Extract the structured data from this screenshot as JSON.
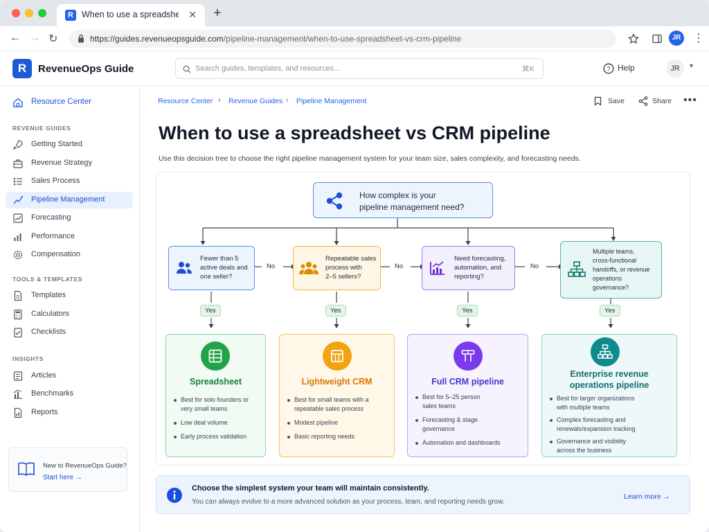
{
  "browser": {
    "tab_title": "When to use a spreadsheet vs CRM pipeline",
    "url_host": "https://guides.revenueopsguide.com",
    "url_path": "/pipeline-management/when-to-use-spreadsheet-vs-crm-pipeline",
    "profile": "JR"
  },
  "header": {
    "logo_letter": "R",
    "brand": "RevenueOps Guide",
    "search_placeholder": "Search guides, templates, and resources...",
    "search_shortcut": "⌘K",
    "help": "Help",
    "user_initials": "JR"
  },
  "sidebar": {
    "home": "Resource Center",
    "sections": [
      {
        "title": "REVENUE GUIDES",
        "items": [
          "Getting Started",
          "Revenue Strategy",
          "Sales Process",
          "Pipeline Management",
          "Forecasting",
          "Performance",
          "Compensation"
        ]
      },
      {
        "title": "TOOLS & TEMPLATES",
        "items": [
          "Templates",
          "Calculators",
          "Checklists"
        ]
      },
      {
        "title": "INSIGHTS",
        "items": [
          "Articles",
          "Benchmarks",
          "Reports"
        ]
      }
    ],
    "active_item": "Pipeline Management",
    "promo_title": "New to RevenueOps Guide?",
    "promo_link": "Start here →"
  },
  "main": {
    "breadcrumb": [
      "Resource Center",
      "Revenue Guides",
      "Pipeline Management"
    ],
    "save": "Save",
    "share": "Share",
    "title": "When to use a spreadsheet vs CRM pipeline",
    "subtitle": "Use this decision tree to choose the right pipeline management system for your team size, sales complexity, and forecasting needs."
  },
  "tree": {
    "root": [
      "How complex is your",
      "pipeline management need?"
    ],
    "no_label": "No",
    "yes_label": "Yes",
    "questions": [
      [
        "Fewer than 5",
        "active deals and",
        "one seller?"
      ],
      [
        "Repeatable sales",
        "process with",
        "2–5 sellers?"
      ],
      [
        "Need forecasting,",
        "automation, and",
        "reporting?"
      ],
      [
        "Multiple teams,",
        "cross-functional",
        "handoffs, or revenue",
        "operations",
        "governance?"
      ]
    ],
    "results": [
      {
        "title": [
          "Spreadsheet"
        ],
        "bullets": [
          [
            "Best for solo founders or",
            "very small teams"
          ],
          [
            "Low deal volume"
          ],
          [
            "Early process validation"
          ]
        ]
      },
      {
        "title": [
          "Lightweight CRM"
        ],
        "bullets": [
          [
            "Best for small teams with a",
            "repeatable sales process"
          ],
          [
            "Modest pipeline"
          ],
          [
            "Basic reporting needs"
          ]
        ]
      },
      {
        "title": [
          "Full CRM pipeline"
        ],
        "bullets": [
          [
            "Best for 5–25 person",
            "sales teams"
          ],
          [
            "Forecasting & stage",
            "governance"
          ],
          [
            "Automation and dashboards"
          ]
        ]
      },
      {
        "title": [
          "Enterprise revenue",
          "operations pipeline"
        ],
        "bullets": [
          [
            "Best for larger organizations",
            "with multiple teams"
          ],
          [
            "Complex forecasting and",
            "renewals/expansion tracking"
          ],
          [
            "Governance and visibility",
            "across the business"
          ]
        ]
      }
    ]
  },
  "banner": {
    "title": "Choose the simplest system your team will maintain consistently.",
    "body": "You can always evolve to a more advanced solution as your process, team, and reporting needs grow.",
    "link": "Learn more →"
  },
  "colors": {
    "blue": "#2563eb",
    "green": "#16a34a",
    "orange": "#f59e0b",
    "purple": "#7c3aed",
    "teal": "#0f8b8d"
  }
}
